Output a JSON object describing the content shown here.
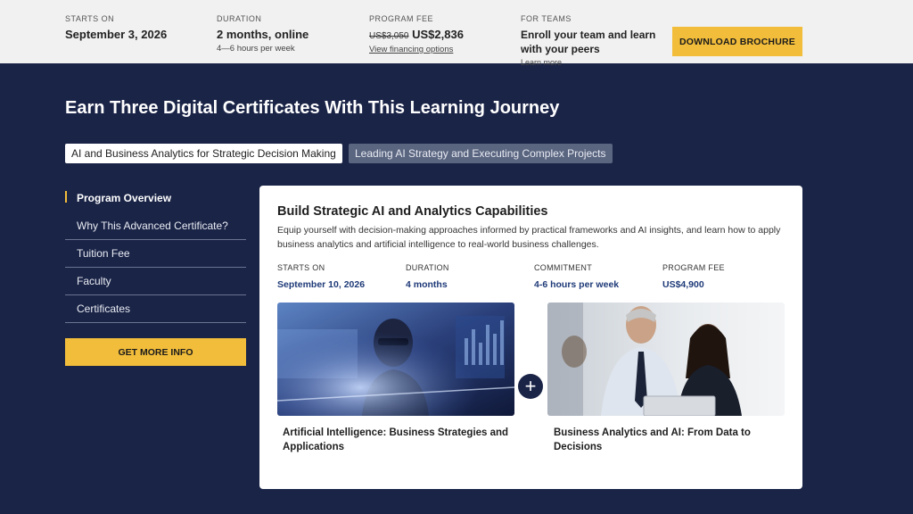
{
  "topbar": {
    "starts_label": "STARTS ON",
    "starts_value": "September 3, 2026",
    "duration_label": "DURATION",
    "duration_value": "2 months, online",
    "duration_sub": "4—6 hours per week",
    "fee_label": "PROGRAM FEE",
    "fee_old": "US$3,050",
    "fee_new": "US$2,836",
    "fee_link": "View financing options",
    "teams_label": "FOR TEAMS",
    "teams_value": "Enroll your team and learn with your peers",
    "teams_link": "Learn more",
    "brochure_button": "DOWNLOAD BROCHURE"
  },
  "heading": "Earn Three Digital Certificates With This Learning Journey",
  "cert_tabs": [
    {
      "label": "AI and Business Analytics for Strategic Decision Making"
    },
    {
      "label": "Leading AI Strategy and Executing Complex Projects"
    }
  ],
  "nav": {
    "items": [
      {
        "label": "Program Overview"
      },
      {
        "label": "Why This Advanced Certificate?"
      },
      {
        "label": "Tuition Fee"
      },
      {
        "label": "Faculty"
      },
      {
        "label": "Certificates"
      }
    ],
    "info_button": "GET MORE INFO"
  },
  "card": {
    "title": "Build Strategic AI and Analytics Capabilities",
    "description": "Equip yourself with decision-making approaches informed by practical frameworks and AI insights, and learn how to apply business analytics and artificial intelligence to real-world business challenges.",
    "stats": [
      {
        "label": "STARTS ON",
        "value": "September 10, 2026"
      },
      {
        "label": "DURATION",
        "value": "4 months"
      },
      {
        "label": "COMMITMENT",
        "value": "4-6 hours per week"
      },
      {
        "label": "PROGRAM FEE",
        "value": "US$4,900"
      }
    ],
    "courses": [
      {
        "title": "Artificial Intelligence: Business Strategies and Applications",
        "image": "person-at-screens-photo"
      },
      {
        "title": "Business Analytics and AI: From Data to Decisions",
        "image": "colleagues-with-laptop-photo"
      }
    ],
    "plus_icon": "plus-icon"
  },
  "colors": {
    "background": "#1a2447",
    "accent": "#f2bd3a",
    "stat_value": "#1e3a78"
  }
}
